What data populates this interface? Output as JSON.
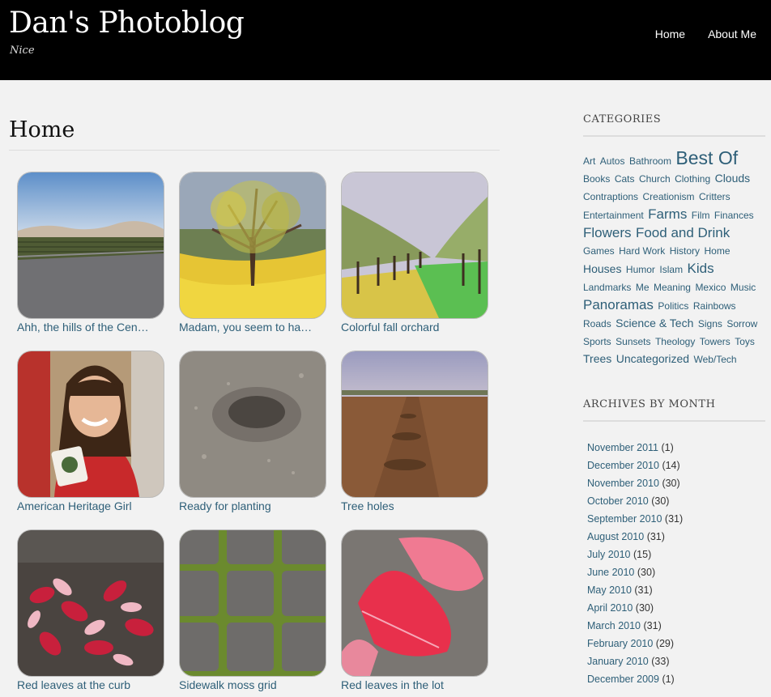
{
  "header": {
    "title": "Dan's Photoblog",
    "tagline": "Nice",
    "nav": [
      {
        "label": "Home"
      },
      {
        "label": "About Me"
      }
    ]
  },
  "main": {
    "title": "Home",
    "posts": [
      {
        "caption": "Ahh, the hills of the Cen…",
        "photo": "hills-field-photo"
      },
      {
        "caption": "Madam, you seem to ha…",
        "photo": "yellow-tree-photo"
      },
      {
        "caption": "Colorful fall orchard",
        "photo": "orchard-photo"
      },
      {
        "caption": "American Heritage Girl",
        "photo": "girl-photo"
      },
      {
        "caption": "Ready for planting",
        "photo": "dirt-hole-photo"
      },
      {
        "caption": "Tree holes",
        "photo": "tree-holes-photo"
      },
      {
        "caption": "Red leaves at the curb",
        "photo": "red-leaves-curb-photo"
      },
      {
        "caption": "Sidewalk moss grid",
        "photo": "moss-grid-photo"
      },
      {
        "caption": "Red leaves in the lot",
        "photo": "red-leaves-lot-photo"
      }
    ]
  },
  "sidebar": {
    "categories_title": "CATEGORIES",
    "categories": [
      {
        "label": "Art",
        "size": "s"
      },
      {
        "label": "Autos",
        "size": "s"
      },
      {
        "label": "Bathroom",
        "size": "s"
      },
      {
        "label": "Best Of",
        "size": "xl"
      },
      {
        "label": "Books",
        "size": "s"
      },
      {
        "label": "Cats",
        "size": "s"
      },
      {
        "label": "Church",
        "size": "s"
      },
      {
        "label": "Clothing",
        "size": "s"
      },
      {
        "label": "Clouds",
        "size": "m"
      },
      {
        "label": "Contraptions",
        "size": "s"
      },
      {
        "label": "Creationism",
        "size": "s"
      },
      {
        "label": "Critters",
        "size": "s"
      },
      {
        "label": "Entertainment",
        "size": "s"
      },
      {
        "label": "Farms",
        "size": "l"
      },
      {
        "label": "Film",
        "size": "s"
      },
      {
        "label": "Finances",
        "size": "s"
      },
      {
        "label": "Flowers",
        "size": "l"
      },
      {
        "label": "Food and Drink",
        "size": "l"
      },
      {
        "label": "Games",
        "size": "s"
      },
      {
        "label": "Hard Work",
        "size": "s"
      },
      {
        "label": "History",
        "size": "s"
      },
      {
        "label": "Home",
        "size": "s"
      },
      {
        "label": "Houses",
        "size": "m"
      },
      {
        "label": "Humor",
        "size": "s"
      },
      {
        "label": "Islam",
        "size": "s"
      },
      {
        "label": "Kids",
        "size": "l"
      },
      {
        "label": "Landmarks",
        "size": "s"
      },
      {
        "label": "Me",
        "size": "s"
      },
      {
        "label": "Meaning",
        "size": "s"
      },
      {
        "label": "Mexico",
        "size": "s"
      },
      {
        "label": "Music",
        "size": "s"
      },
      {
        "label": "Panoramas",
        "size": "l"
      },
      {
        "label": "Politics",
        "size": "s"
      },
      {
        "label": "Rainbows",
        "size": "s"
      },
      {
        "label": "Roads",
        "size": "s"
      },
      {
        "label": "Science & Tech",
        "size": "m"
      },
      {
        "label": "Signs",
        "size": "s"
      },
      {
        "label": "Sorrow",
        "size": "s"
      },
      {
        "label": "Sports",
        "size": "s"
      },
      {
        "label": "Sunsets",
        "size": "s"
      },
      {
        "label": "Theology",
        "size": "s"
      },
      {
        "label": "Towers",
        "size": "s"
      },
      {
        "label": "Toys",
        "size": "s"
      },
      {
        "label": "Trees",
        "size": "m"
      },
      {
        "label": "Uncategorized",
        "size": "m"
      },
      {
        "label": "Web/Tech",
        "size": "s"
      }
    ],
    "archives_title": "ARCHIVES BY MONTH",
    "archives": [
      {
        "month": "November 2011",
        "count": "(1)"
      },
      {
        "month": "December 2010",
        "count": "(14)"
      },
      {
        "month": "November 2010",
        "count": "(30)"
      },
      {
        "month": "October 2010",
        "count": "(30)"
      },
      {
        "month": "September 2010",
        "count": "(31)"
      },
      {
        "month": "August 2010",
        "count": "(31)"
      },
      {
        "month": "July 2010",
        "count": "(15)"
      },
      {
        "month": "June 2010",
        "count": "(30)"
      },
      {
        "month": "May 2010",
        "count": "(31)"
      },
      {
        "month": "April 2010",
        "count": "(30)"
      },
      {
        "month": "March 2010",
        "count": "(31)"
      },
      {
        "month": "February 2010",
        "count": "(29)"
      },
      {
        "month": "January 2010",
        "count": "(33)"
      },
      {
        "month": "December 2009",
        "count": "(1)"
      }
    ]
  }
}
